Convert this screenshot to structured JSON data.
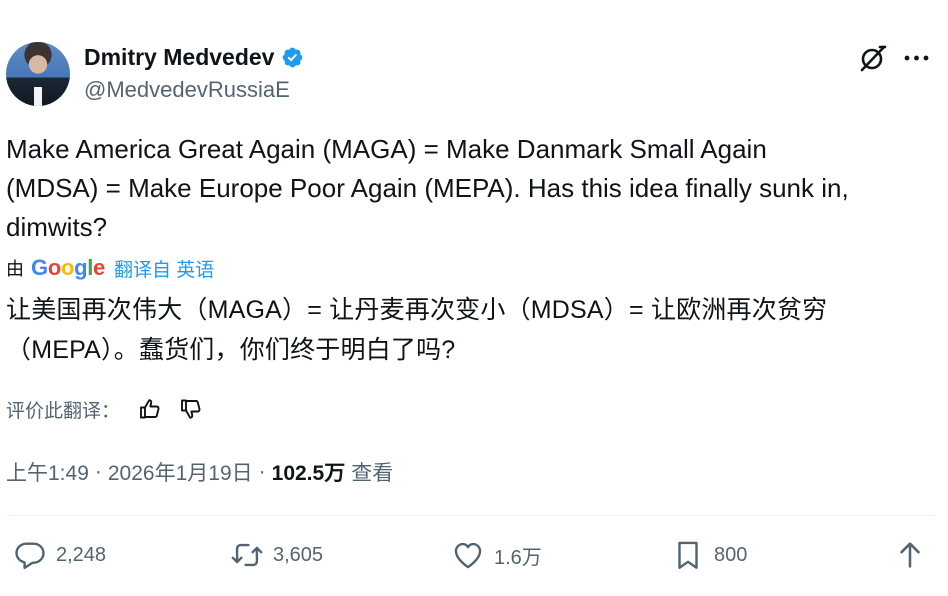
{
  "author": {
    "name": "Dmitry Medvedev",
    "handle": "@MedvedevRussiaE",
    "verified": true,
    "verified_color": "#1d9bf0"
  },
  "tweet": {
    "text": "Make America Great Again (MAGA) = Make Danmark Small Again\n(MDSA) = Make Europe Poor Again (MEPA). Has this idea finally sunk in,\ndimwits?"
  },
  "translation": {
    "by_label": "由",
    "google_letters": [
      "G",
      "o",
      "o",
      "g",
      "l",
      "e"
    ],
    "translated_from": "翻译自 英语",
    "text": "让美国再次伟大（MAGA）= 让丹麦再次变小（MDSA）= 让欧洲再次贫穷\n（MEPA）。蠢货们，你们终于明白了吗?",
    "rate_label": "评价此翻译："
  },
  "meta": {
    "time": "上午1:49",
    "separator": "·",
    "date": "2026年1月19日",
    "views_count": "102.5万",
    "views_label": "查看"
  },
  "actions": {
    "replies": "2,248",
    "reposts": "3,605",
    "likes": "1.6万",
    "bookmarks": "800"
  },
  "icons": {
    "grok": "grok-icon",
    "more": "more-dots-icon",
    "thumbs_up": "thumbs-up-icon",
    "thumbs_down": "thumbs-down-icon",
    "reply": "reply-bubble-icon",
    "retweet": "retweet-icon",
    "like": "heart-icon",
    "bookmark": "bookmark-icon",
    "share": "share-icon"
  },
  "colors": {
    "text_primary": "#0f1419",
    "text_secondary": "#536471",
    "link_blue": "#1d9bf0"
  }
}
